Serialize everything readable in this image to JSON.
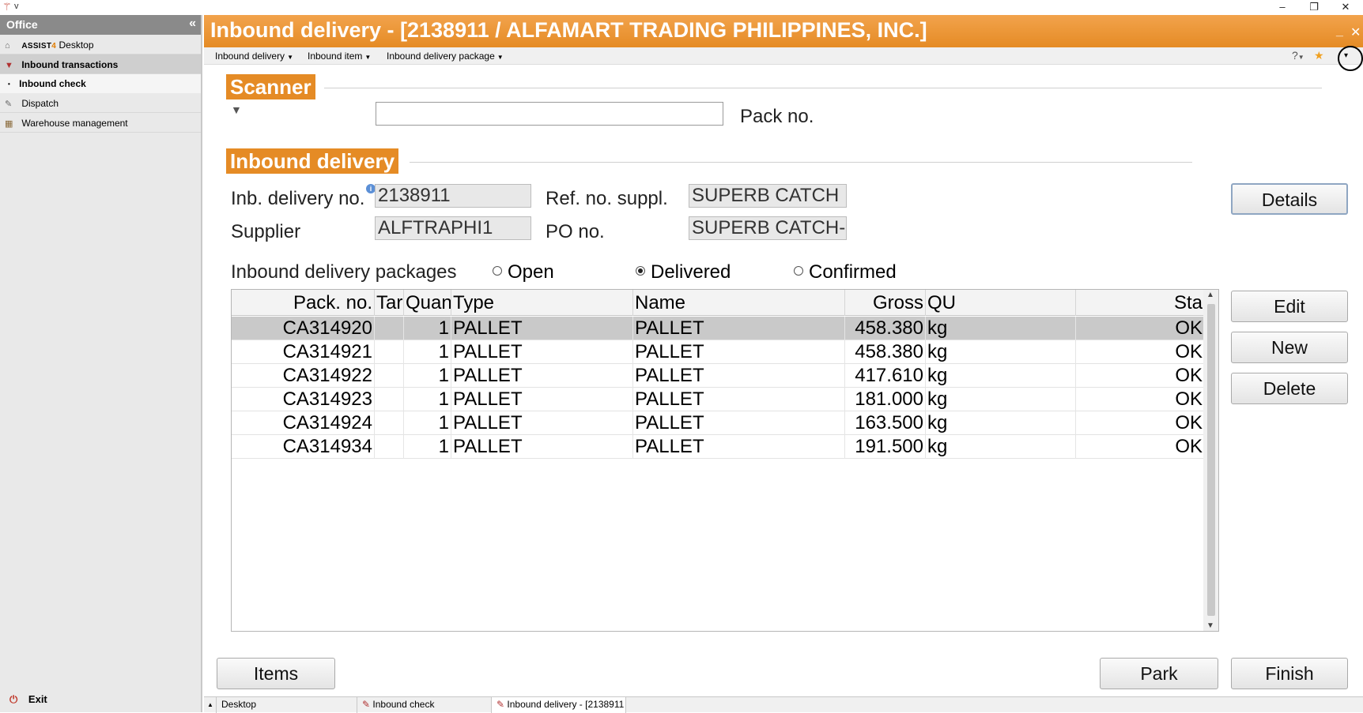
{
  "os": {
    "title": "v",
    "minimize": "–",
    "restore": "❐",
    "close": "✕"
  },
  "sidebar": {
    "header": "Office",
    "collapse_glyph": "«",
    "items": [
      {
        "logo_main": "ASSIST",
        "logo_four": "4",
        "label": "Desktop"
      },
      {
        "label": "Inbound transactions"
      },
      {
        "label": "Inbound check"
      },
      {
        "label": "Dispatch"
      },
      {
        "label": "Warehouse management"
      }
    ],
    "exit_label": "Exit"
  },
  "window": {
    "title": "Inbound delivery - [2138911 / ALFAMART TRADING PHILIPPINES, INC.]",
    "minimize": "_",
    "close": "✕"
  },
  "menu": {
    "items": [
      "Inbound delivery",
      "Inbound item",
      "Inbound delivery package"
    ],
    "help": "?",
    "favorite": "★",
    "more": "▾"
  },
  "scanner": {
    "section": "Scanner",
    "input_value": "",
    "field_label": "Pack no."
  },
  "delivery": {
    "section": "Inbound delivery",
    "inb_no_label": "Inb. delivery no.",
    "inb_no_value": "2138911",
    "supplier_label": "Supplier",
    "supplier_value": "ALFTRAPHI1",
    "ref_label": "Ref. no. suppl.",
    "ref_value": "SUPERB CATCH",
    "po_label": "PO no.",
    "po_value": "SUPERB CATCH-",
    "details_button": "Details"
  },
  "packages": {
    "label": "Inbound delivery packages",
    "filters": [
      "Open",
      "Delivered",
      "Confirmed"
    ],
    "selected_filter": "Delivered",
    "columns": [
      "Pack. no.",
      "Tar",
      "Quan",
      "Type",
      "Name",
      "Gross",
      "QU",
      "Sta"
    ],
    "rows": [
      [
        "CA314920",
        "",
        "1",
        "PALLET",
        "PALLET",
        "458.380",
        "kg",
        "OK"
      ],
      [
        "CA314921",
        "",
        "1",
        "PALLET",
        "PALLET",
        "458.380",
        "kg",
        "OK"
      ],
      [
        "CA314922",
        "",
        "1",
        "PALLET",
        "PALLET",
        "417.610",
        "kg",
        "OK"
      ],
      [
        "CA314923",
        "",
        "1",
        "PALLET",
        "PALLET",
        "181.000",
        "kg",
        "OK"
      ],
      [
        "CA314924",
        "",
        "1",
        "PALLET",
        "PALLET",
        "163.500",
        "kg",
        "OK"
      ],
      [
        "CA314934",
        "",
        "1",
        "PALLET",
        "PALLET",
        "191.500",
        "kg",
        "OK"
      ]
    ],
    "buttons": {
      "edit": "Edit",
      "new": "New",
      "delete": "Delete"
    }
  },
  "footer": {
    "items": "Items",
    "park": "Park",
    "finish": "Finish"
  },
  "taskbar": {
    "tabs": [
      "Desktop",
      "Inbound check",
      "Inbound delivery - [2138911"
    ]
  }
}
